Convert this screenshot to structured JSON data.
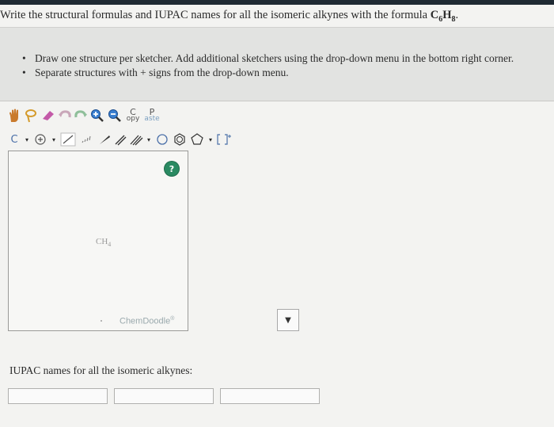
{
  "question": {
    "prefix": "Write the structural formulas and IUPAC names for all the isomeric alkynes with the formula ",
    "formula_c": "C",
    "formula_c_sub": "6",
    "formula_h": "H",
    "formula_h_sub": "8",
    "suffix": "."
  },
  "instructions": [
    "Draw one structure per sketcher. Add additional sketchers using the drop-down menu in the bottom right corner.",
    "Separate structures with + signs from the drop-down menu."
  ],
  "toolbar": {
    "copy_top": "C",
    "copy_bottom": "opy",
    "paste_top": "P",
    "paste_bottom": "aste",
    "element_label": "C"
  },
  "canvas": {
    "molecule_main": "CH",
    "molecule_sub": "4",
    "help_symbol": "?",
    "brand": "ChemDoodle"
  },
  "iupac_label": "IUPAC names for all the isomeric alkynes:",
  "answer_inputs": [
    "",
    "",
    ""
  ],
  "colors": {
    "help": "#2a8a62",
    "accent": "#1f2a33"
  }
}
